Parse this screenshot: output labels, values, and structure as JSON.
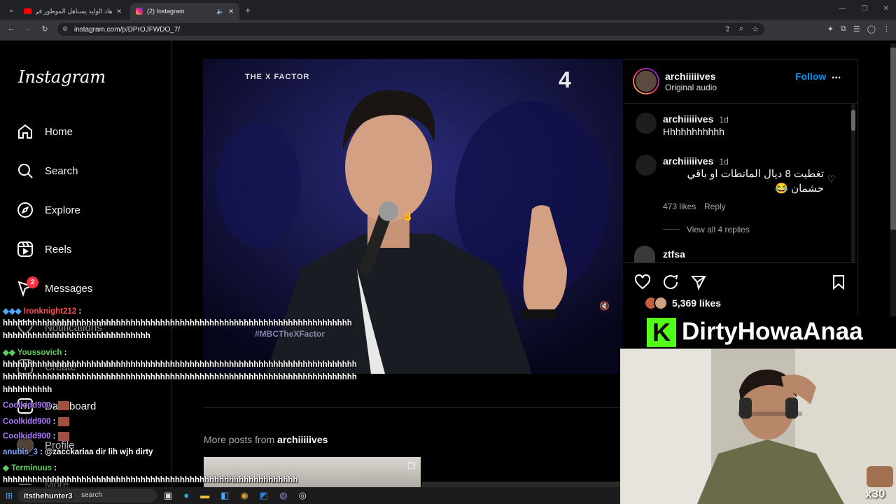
{
  "browser": {
    "tabs": [
      {
        "title": "ﻫﺎﺩ ﺍﻟﻮﻟﻴﺪ ﻳﺴﺘﺎﻫﻞ ﺍﻟﻤﻮﻃﻮﺭ ﻓﻲ"
      },
      {
        "title": "(2) Instagram"
      }
    ],
    "new_tab": "+",
    "url": "instagram.com/p/DPrOJFWDO_7/"
  },
  "sidebar": {
    "logo": "Instagram",
    "items": [
      {
        "label": "Home",
        "icon": "home-icon"
      },
      {
        "label": "Search",
        "icon": "search-icon"
      },
      {
        "label": "Explore",
        "icon": "compass-icon"
      },
      {
        "label": "Reels",
        "icon": "reels-icon"
      },
      {
        "label": "Messages",
        "icon": "messenger-icon",
        "badge": "2"
      },
      {
        "label": "Notifications",
        "icon": "heart-icon"
      },
      {
        "label": "Create",
        "icon": "plus-icon"
      },
      {
        "label": "Dashboard",
        "icon": "dashboard-icon"
      },
      {
        "label": "Profile",
        "icon": "avatar"
      },
      {
        "label": "More",
        "icon": "menu-icon"
      }
    ]
  },
  "video": {
    "watermark_left": "THE X FACTOR",
    "watermark_right": "4",
    "hashtag": "#MBCTheXFactor"
  },
  "post": {
    "author": "archiiiiives",
    "audio": "Original audio",
    "follow": "Follow",
    "more": "...",
    "comments": [
      {
        "user": "archiiiiives",
        "time": "1d",
        "text": "Hhhhhhhhhhh"
      },
      {
        "user": "archiiiiives",
        "time": "1d",
        "text_line1": "ﺗﻐﻄﻴﺖ 8 ﺩﻳﺎﻝ ﺍﻟﻤﺎﻧﻄﺎﺕ ﺍﻭ ﺑﺎﻗﻲ",
        "text_line2": "ﺣﺸﻤﺎﻥ 😂",
        "likes": "473 likes",
        "reply": "Reply",
        "view_replies": "View all 4 replies"
      },
      {
        "user": "ztfsa"
      }
    ],
    "likes": "5,369 likes",
    "more_posts_label": "More posts from",
    "more_posts_user": "archiiiiives"
  },
  "overlay": {
    "streamer": "DirtyHowaAnaa",
    "kick_logo": "K",
    "chat": [
      {
        "user": "Ironknight212",
        "sep": " :",
        "color": "#ff4d4d",
        "lines": [
          "hhhhhhhhhhhhhhhhhhhhhhhhhhhhhhhhhhhhhhhhhhhhhhhhhhhhhhhhhhhhhhhhhhhhhhh",
          "hhhhhhhhhhhhhhhhhhhhhhhhhhhhhh"
        ]
      },
      {
        "user": "Youssovich",
        "sep": " :",
        "color": "#5dcf5d",
        "lines": [
          "hhhhhhhhhhhhhhhhhhhhhhhhhhhhhhhhhhhhhhhhhhhhhhhhhhhhhhhhhhhhhhhhhhhhhhhh",
          "hhhhhhhhhhhhhhhhhhhhhhhhhhhhhhhhhhhhhhhhhhhhhhhhhhhhhhhhhhhhhhhhhhhhhhhh",
          "hhhhhhhhhh"
        ]
      },
      {
        "user": "Coolkidd900",
        "sep": " :",
        "color": "#b07cff",
        "lines": []
      },
      {
        "user": "Coolkidd900",
        "sep": " :",
        "color": "#b07cff",
        "lines": []
      },
      {
        "user": "Coolkidd900",
        "sep": " :",
        "color": "#b07cff",
        "lines": []
      },
      {
        "user": "anubis_3",
        "sep": " : @zacckariaa dir lih wjh dirty",
        "color": "#7aa8ff",
        "lines": []
      },
      {
        "user": "Terminuus",
        "sep": " :",
        "color": "#5dcf5d",
        "lines": [
          "hhhhhhhhhhhhhhhhhhhhhhhhhhhhhhhhhhhhhhhhhhhhhhhhhhhhhhhhhhhh"
        ]
      },
      {
        "user": "itsthehunter3",
        "sep": "",
        "color": "#ff9c3a",
        "lines": []
      }
    ],
    "sub_count": "x30"
  },
  "taskbar": {
    "search": "search"
  },
  "colors": {
    "accent": "#0095f6",
    "kick": "#53fc18",
    "badge": "#ff3040"
  }
}
